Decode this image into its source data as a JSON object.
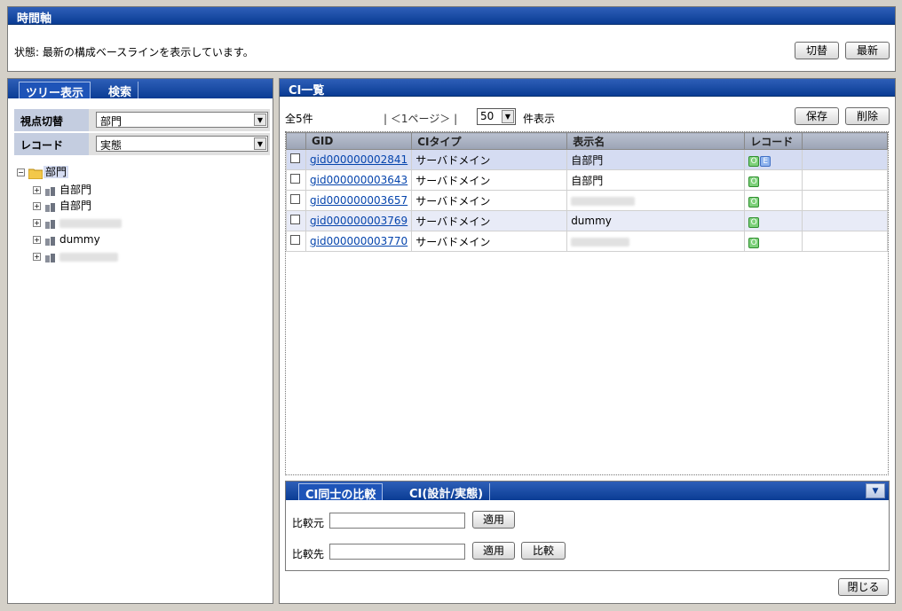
{
  "top": {
    "title": "時間軸",
    "status_text": "状態: 最新の構成ベースラインを表示しています。",
    "switch_button": "切替",
    "latest_button": "最新"
  },
  "left": {
    "tabs": [
      "ツリー表示",
      "検索"
    ],
    "viewpoint_label": "視点切替",
    "viewpoint_value": "部門",
    "record_label": "レコード",
    "record_value": "実態",
    "tree_root": "部門",
    "tree_items": [
      "自部門",
      "自部門",
      "",
      "dummy",
      ""
    ]
  },
  "right": {
    "title": "CI一覧",
    "total": "全5件",
    "pager": "| ＜1ページ＞ |",
    "per_page_value": "50",
    "per_page_suffix": "件表示",
    "save_button": "保存",
    "delete_button": "削除",
    "columns": [
      "GID",
      "CIタイプ",
      "表示名",
      "レコード"
    ],
    "rows": [
      {
        "gid": "gid000000002841",
        "type": "サーバドメイン",
        "name": "自部門",
        "badges": [
          "O",
          "E"
        ]
      },
      {
        "gid": "gid000000003643",
        "type": "サーバドメイン",
        "name": "自部門",
        "badges": [
          "O"
        ]
      },
      {
        "gid": "gid000000003657",
        "type": "サーバドメイン",
        "name": "",
        "badges": [
          "O"
        ]
      },
      {
        "gid": "gid000000003769",
        "type": "サーバドメイン",
        "name": "dummy",
        "badges": [
          "O"
        ]
      },
      {
        "gid": "gid000000003770",
        "type": "サーバドメイン",
        "name": "",
        "badges": [
          "O"
        ]
      }
    ]
  },
  "compare": {
    "tabs": [
      "CI同士の比較",
      "CI(設計/実態)"
    ],
    "source_label": "比較元",
    "target_label": "比較先",
    "apply_button": "適用",
    "compare_button": "比較"
  },
  "close_button": "閉じる",
  "colors": {
    "header_blue": "#0a3c94",
    "selected_row": "#d5dcf2",
    "badge_o": "#7ed17b",
    "badge_e": "#8fb4ee"
  }
}
